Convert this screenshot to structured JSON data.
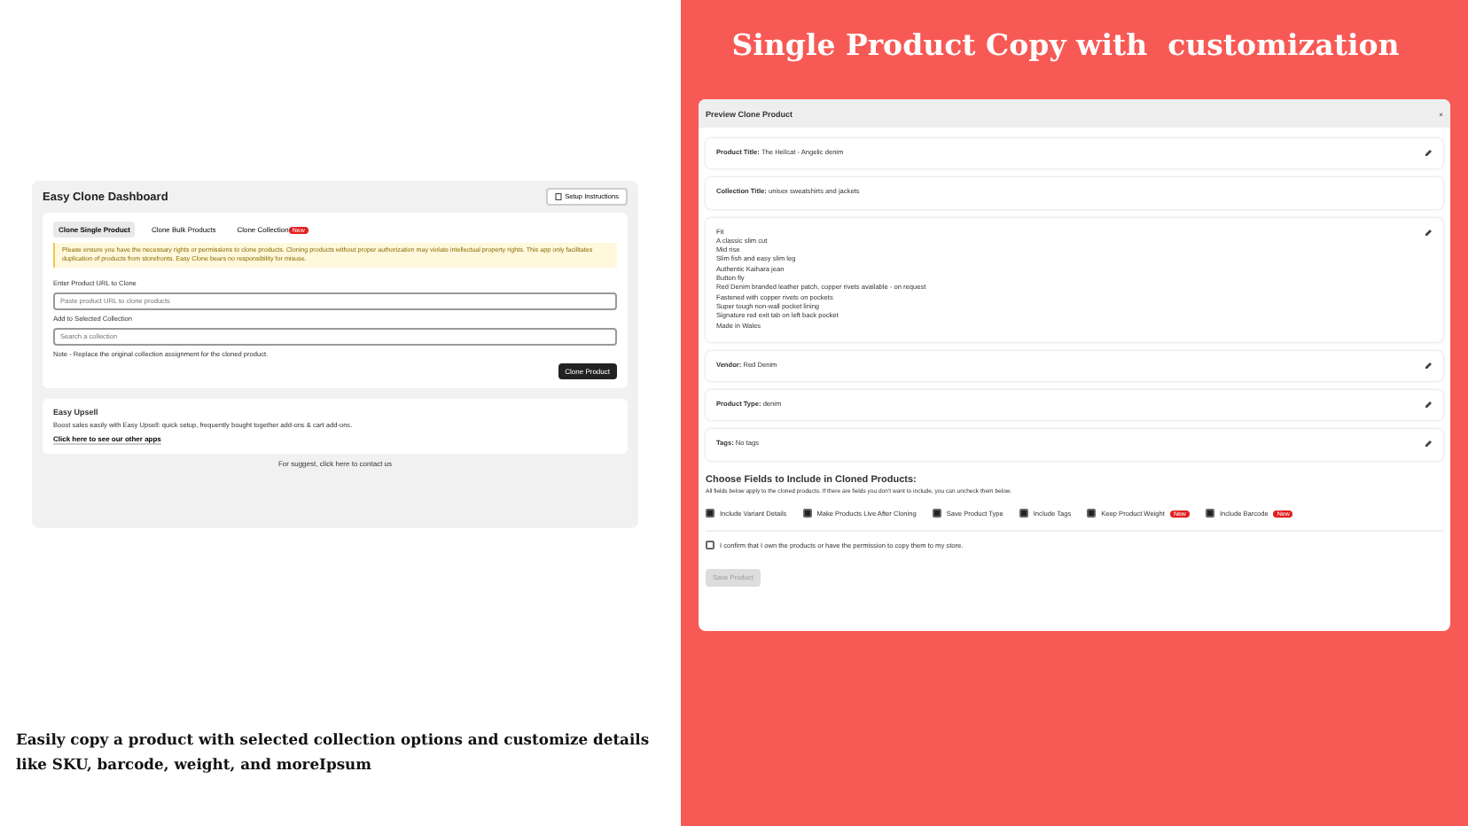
{
  "caption": {
    "lines": [
      "Easily copy a product with selected collection options and customize details",
      "like SKU, barcode, weight, and moreIpsum"
    ]
  },
  "headline": "Single Product Copy with  customization",
  "dashboard": {
    "title": "Easy Clone Dashboard",
    "setup_button": "Setup Instructions",
    "tabs": [
      {
        "label": "Clone Single Product",
        "selected": true
      },
      {
        "label": "Clone Bulk Products",
        "selected": false
      },
      {
        "label": "Clone Collection",
        "selected": false,
        "badge": "New"
      }
    ],
    "notice": "Please ensure you have the necessary rights or permissions to clone products. Cloning products without proper authorization may violate intellectual property rights. This app only facilitates duplication of products from storefronts. Easy Clone bears no responsibility for misuse.",
    "url_label": "Enter Product URL to Clone",
    "url_placeholder": "Paste product URL to clone products",
    "collection_label": "Add to Selected Collection",
    "collection_placeholder": "Search a collection",
    "note": "Note - Replace the original collection assignment for the cloned product.",
    "clone_button": "Clone Product",
    "upsell": {
      "title": "Easy Upsell",
      "text": "Boost sales easily with Easy Upsell: quick setup, frequently bought together add-ons & cart add-ons.",
      "link": "Click here to see our other apps"
    },
    "footer": "For suggest, click here to contact us"
  },
  "preview": {
    "title": "Preview Clone Product",
    "close": "×",
    "fields": [
      {
        "label": "Product Title:",
        "value": "The Hellcat - Angelic denim",
        "editable": true
      },
      {
        "label": "Collection Title:",
        "value": "unisex sweatshirts and jackets",
        "editable": false
      },
      {
        "lines": [
          "Fit",
          "A classic slim cut",
          "Mid rise",
          "Slim fish and easy slim leg",
          "Authentic Kaihara jean",
          "Button fly",
          "Red Denim branded leather patch, copper rivets available - on request",
          "Fastened with copper rivets on pockets",
          "Super tough non-wall pocket lining",
          "Signature red exit tab on left back pocket",
          "Made in Wales"
        ],
        "editable": true
      },
      {
        "label": "Vendor:",
        "value": "Red Denim",
        "editable": true
      },
      {
        "label": "Product Type:",
        "value": "denim",
        "editable": true
      },
      {
        "label": "Tags:",
        "value": "No tags",
        "editable": true
      }
    ],
    "options_title": "Choose Fields to Include in Cloned Products:",
    "options_hint": "All fields below apply to the cloned products. If there are fields you don't want to include, you can uncheck them below.",
    "options": [
      {
        "label": "Include Variant Details",
        "checked": true
      },
      {
        "label": "Make Products Live After Cloning",
        "checked": true
      },
      {
        "label": "Save Product Type",
        "checked": true
      },
      {
        "label": "Include Tags",
        "checked": true
      },
      {
        "label": "Keep Product Weight",
        "checked": true,
        "badge": "New"
      },
      {
        "label": "Include Barcode",
        "checked": true,
        "badge": "New"
      }
    ],
    "confirm": {
      "label": "I confirm that I own the products or have the permission to copy them to my store.",
      "checked": false
    },
    "save_button": {
      "label": "Save Product",
      "disabled": true
    }
  }
}
